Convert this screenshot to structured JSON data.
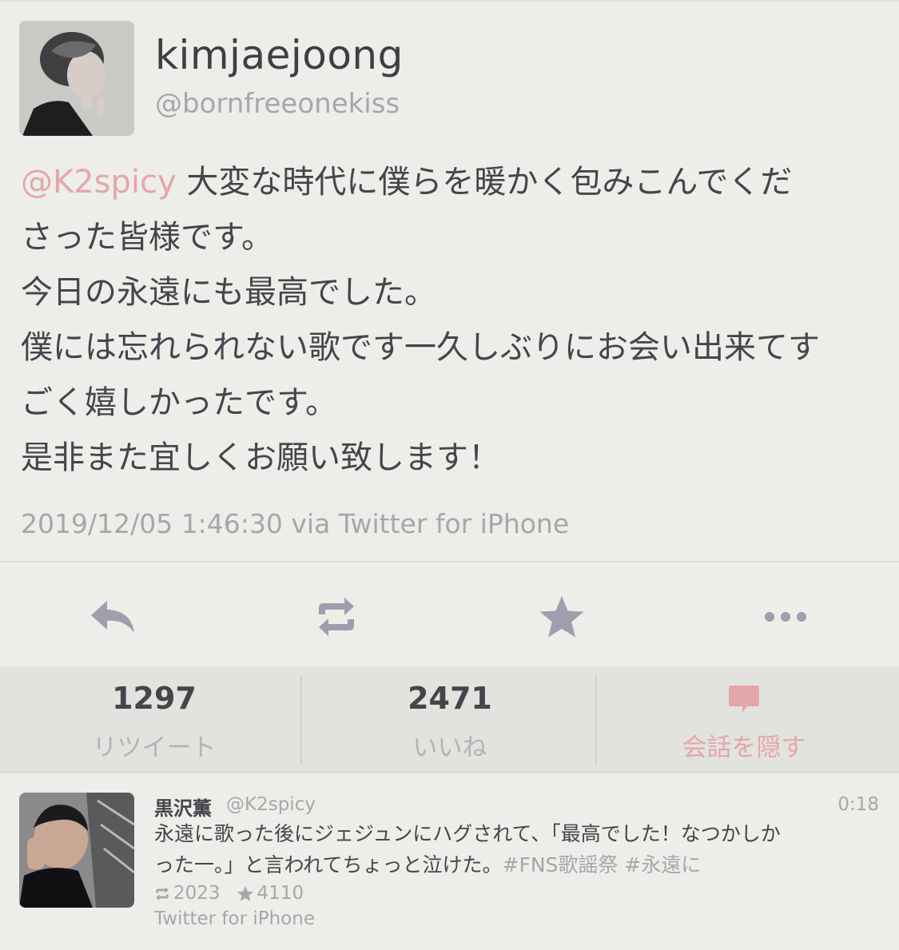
{
  "tweet": {
    "user_name": "kimjaejoong",
    "user_handle": "@bornfreeonekiss",
    "mention": "@K2spicy",
    "lines": [
      " 大変な時代に僕らを暖かく包みこんでくだ",
      "さった皆様です。",
      "今日の永遠にも最高でした。",
      "僕には忘れられない歌です一久しぶりにお会い出来てす",
      "ごく嬉しかったです。",
      "是非また宜しくお願い致します！"
    ],
    "timestamp": "2019/12/05 1:46:30 via Twitter for iPhone"
  },
  "actions": {
    "icons": [
      "reply-icon",
      "retweet-icon",
      "star-icon",
      "more-icon"
    ]
  },
  "stats": {
    "retweets": "1297",
    "retweets_label": "リツイート",
    "likes": "2471",
    "likes_label": "いいね",
    "hide_label": "会話を隠す",
    "accent_color": "#e4a7a9"
  },
  "reply": {
    "name": "黒沢薫",
    "handle": "@K2spicy",
    "time": "0:18",
    "line1": "永遠に歌った後にジェジュンにハグされて、「最高でした！なつかしか",
    "line2_text": "った一。」と言われてちょっと泣けた。",
    "hashtags": "#FNS歌謡祭  #永遠に",
    "retweets": "2023",
    "likes": "4110",
    "source": "Twitter for iPhone"
  }
}
